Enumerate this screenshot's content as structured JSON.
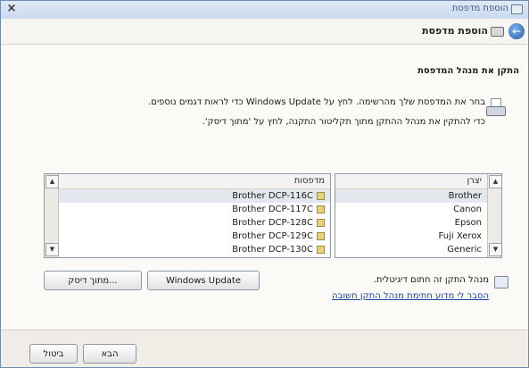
{
  "window": {
    "title": "הוספת מדפסת"
  },
  "nav": {
    "title": "הוספת מדפסת"
  },
  "section": {
    "title": "התקן את מנהל המדפסת",
    "line1": "בחר את המדפסת שלך מהרשימה. לחץ על Windows Update כדי לראות דגמים נוספים.",
    "line2": "כדי להתקין את מנהל ההתקן מתוך תקליטור התקנה, לחץ על 'מתוך דיסק'."
  },
  "manufacturers": {
    "header": "יצרן",
    "items": [
      "Brother",
      "Canon",
      "Epson",
      "Fuji Xerox",
      "Generic"
    ]
  },
  "printers": {
    "header": "מדפסות",
    "items": [
      "Brother DCP-116C",
      "Brother DCP-117C",
      "Brother DCP-128C",
      "Brother DCP-129C",
      "Brother DCP-130C"
    ]
  },
  "buttons": {
    "windows_update": "Windows Update",
    "have_disk": "מתוך דיסק...",
    "next": "הבא",
    "cancel": "ביטול"
  },
  "driver_info": {
    "signed_text": "מנהל התקן זה חתום דיגיטלית.",
    "why_link": "הסבר לי מדוע חתימת מנהל התקן חשובה"
  },
  "icons": {
    "close": "close-icon",
    "back": "back-arrow-icon",
    "printer": "printer-icon",
    "driver": "driver-file-icon",
    "signed": "signed-driver-icon"
  }
}
